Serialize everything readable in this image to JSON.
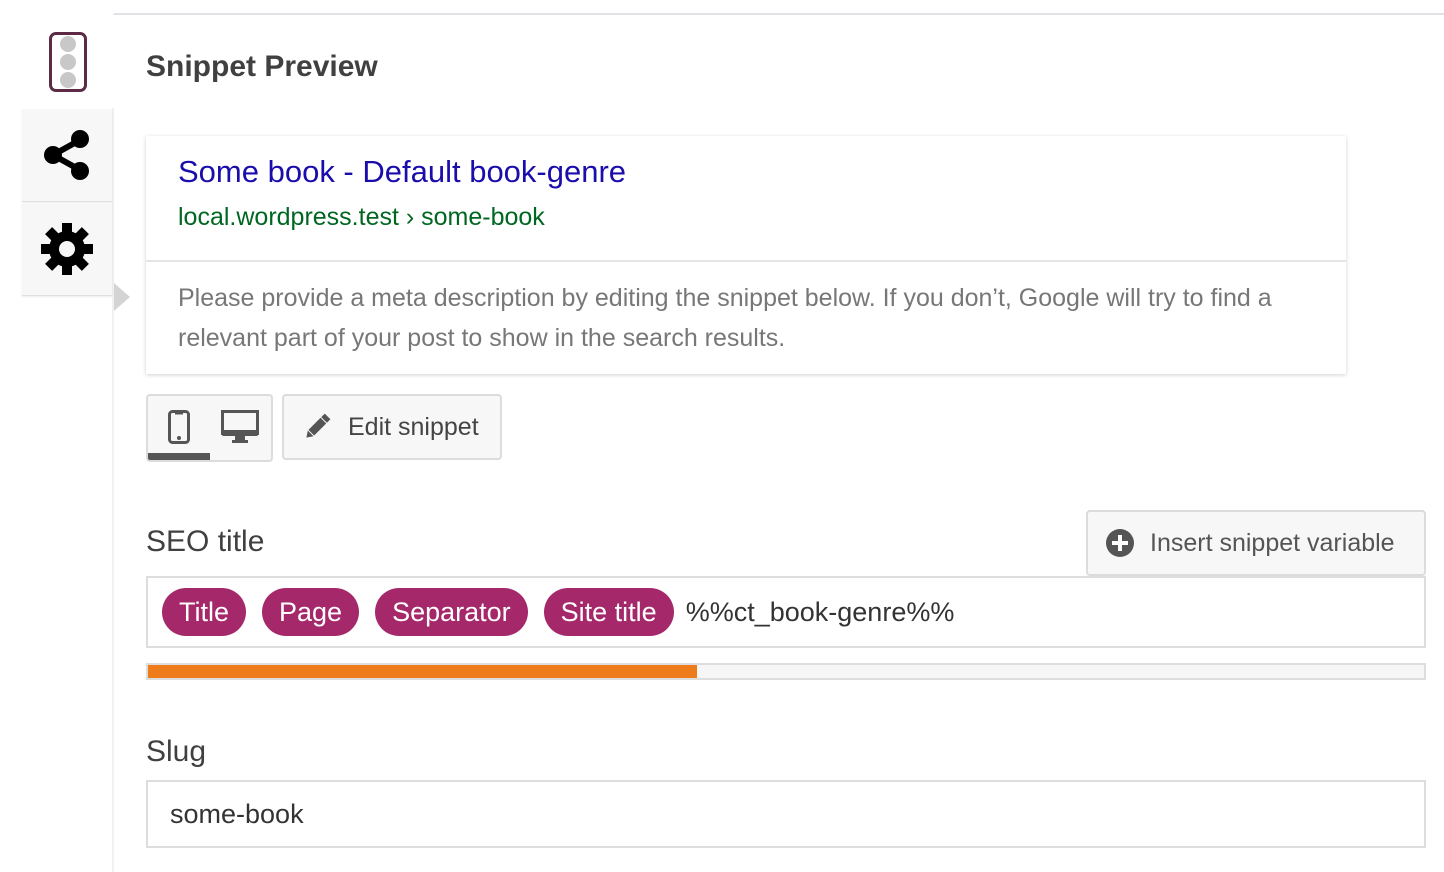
{
  "sidebar": {
    "tabs": [
      {
        "icon": "traffic-light-icon",
        "label": "SEO analysis",
        "active": true
      },
      {
        "icon": "share-icon",
        "label": "Social",
        "active": false
      },
      {
        "icon": "gear-icon",
        "label": "Advanced",
        "active": false
      }
    ]
  },
  "snippet_preview": {
    "heading": "Snippet Preview",
    "title": "Some book - Default book-genre",
    "url": "local.wordpress.test › some-book",
    "description": "Please provide a meta description by editing the snippet below. If you don’t, Google will try to find a relevant part of your post to show in the search results.",
    "mode_buttons": [
      {
        "icon": "mobile-icon",
        "label": "Mobile preview",
        "active": true
      },
      {
        "icon": "desktop-icon",
        "label": "Desktop preview",
        "active": false
      }
    ],
    "edit_button_label": "Edit snippet"
  },
  "seo_title": {
    "label": "SEO title",
    "insert_variable_label": "Insert snippet variable",
    "variables": [
      "Title",
      "Page",
      "Separator",
      "Site title"
    ],
    "text": "%%ct_book-genre%%",
    "progress_percent": 43,
    "progress_color": "#ee7c1b"
  },
  "slug": {
    "label": "Slug",
    "value": "some-book"
  },
  "colors": {
    "pill": "#a4286a",
    "link_title": "#1a0dab",
    "link_url": "#006621"
  }
}
